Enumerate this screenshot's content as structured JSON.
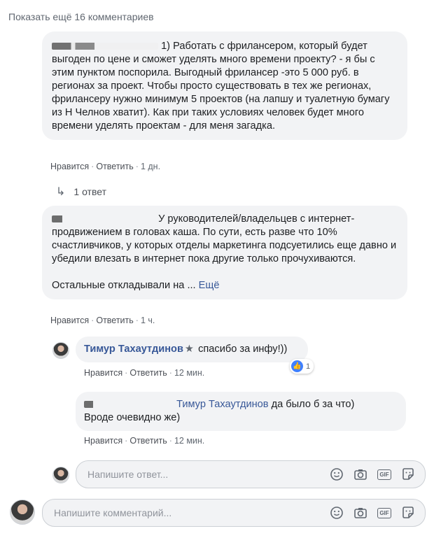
{
  "load_more": "Показать ещё 16 комментариев",
  "comments": [
    {
      "name": "",
      "text": "1) Работать с фрилансером, который будет выгоден по цене и сможет уделять много времени проекту? - я бы с этим пунктом поспорила. Выгодный фрилансер -это 5 000 руб. в регионах за проект. Чтобы просто существовать в тех же регионах, фрилансеру нужно минимум 5 проектов (на лапшу и туалетную бумагу из Н Челнов хватит). Как при таких условиях человек будет много времени уделять проектам - для меня загадка.",
      "like": "Нравится",
      "reply": "Ответить",
      "time": "1 дн."
    },
    {
      "name": "",
      "text": "У руководителей/владельцев с интернет-продвижением в головах каша. По сути, есть разве что 10% счастливчиков, у которых отделы маркетинга подсуетились еще давно и убедили влезать в интернет пока другие только прочухиваются.",
      "text2": "Остальные откладывали на ...",
      "see_more": "Ещё",
      "like": "Нравится",
      "reply": "Ответить",
      "time": "1 ч."
    }
  ],
  "reply_count": "1 ответ",
  "replies": [
    {
      "name": "Тимур Тахаутдинов",
      "badge_icon": "star-icon",
      "text": "спасибо за инфу!))",
      "reaction_count": "1",
      "like": "Нравится",
      "reply": "Ответить",
      "time": "12 мин."
    },
    {
      "name": "",
      "mention": "Тимур Тахаутдинов",
      "text": "да было б за что)",
      "text2": "Вроде очевидно же)",
      "like": "Нравится",
      "reply": "Ответить",
      "time": "12 мин."
    }
  ],
  "reply_box": {
    "placeholder": "Напишите ответ..."
  },
  "comment_box": {
    "placeholder": "Напишите комментарий..."
  },
  "sep": "·"
}
